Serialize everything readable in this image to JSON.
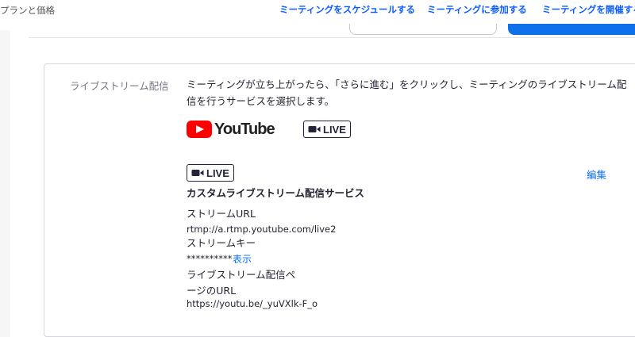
{
  "header": {
    "plan_link": "プランと価格",
    "nav": {
      "schedule": "ミーティングをスケジュールする",
      "join": "ミーティングに参加する",
      "host": "ミーティングを開催する"
    }
  },
  "livestream": {
    "section_label": "ライブストリーム配信",
    "description": "ミーティングが立ち上がったら、「さらに進む」をクリックし、ミーティングのライブストリーム配信を行うサービスを選択します。",
    "youtube_label": "YouTube",
    "live_label": "LIVE",
    "custom": {
      "badge": "LIVE",
      "edit": "編集",
      "title": "カスタムライブストリーム配信サービス",
      "stream_url_label": "ストリームURL",
      "stream_url_value": "rtmp://a.rtmp.youtube.com/live2",
      "stream_key_label": "ストリームキー",
      "stream_key_value": "**********",
      "show": "表示",
      "page_url_label_1": "ライブストリーム配信ペ",
      "page_url_label_2": "ージのURL",
      "page_url_value": "https://youtu.be/_yuVXlk-F_o"
    }
  },
  "colors": {
    "accent": "#0e71eb",
    "nav_link": "#0b5cff",
    "youtube_red": "#ff0000"
  },
  "icons": {
    "youtube_play": "youtube-play-icon",
    "live_camera": "video-camera-icon"
  }
}
